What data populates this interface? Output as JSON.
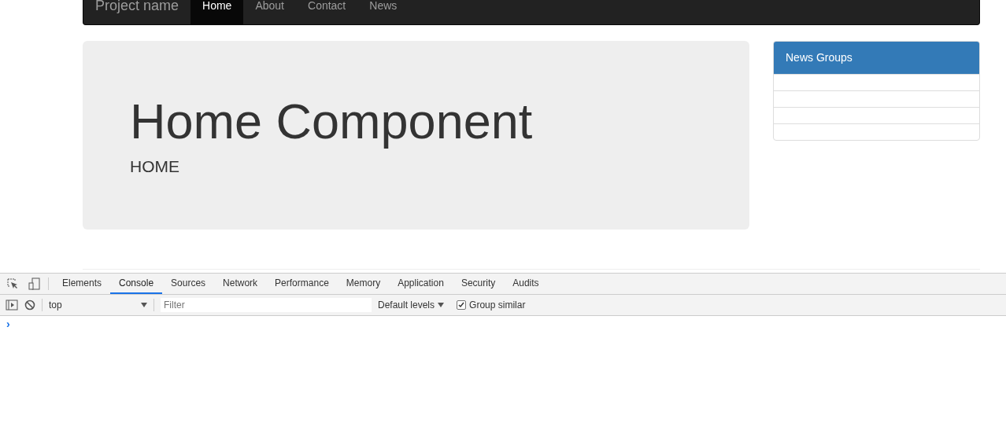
{
  "navbar": {
    "brand": "Project name",
    "links": [
      {
        "label": "Home",
        "selected": true
      },
      {
        "label": "About",
        "selected": false
      },
      {
        "label": "Contact",
        "selected": false
      },
      {
        "label": "News",
        "selected": false
      }
    ]
  },
  "jumbotron": {
    "title": "Home Component",
    "subtitle": "HOME"
  },
  "news_groups": {
    "title": "News Groups"
  },
  "devtools": {
    "tabs": [
      {
        "label": "Elements",
        "selected": false
      },
      {
        "label": "Console",
        "selected": true
      },
      {
        "label": "Sources",
        "selected": false
      },
      {
        "label": "Network",
        "selected": false
      },
      {
        "label": "Performance",
        "selected": false
      },
      {
        "label": "Memory",
        "selected": false
      },
      {
        "label": "Application",
        "selected": false
      },
      {
        "label": "Security",
        "selected": false
      },
      {
        "label": "Audits",
        "selected": false
      }
    ],
    "context": "top",
    "filter_placeholder": "Filter",
    "levels": "Default levels",
    "group_similar": {
      "label": "Group similar",
      "checked": true
    },
    "prompt": "›"
  }
}
